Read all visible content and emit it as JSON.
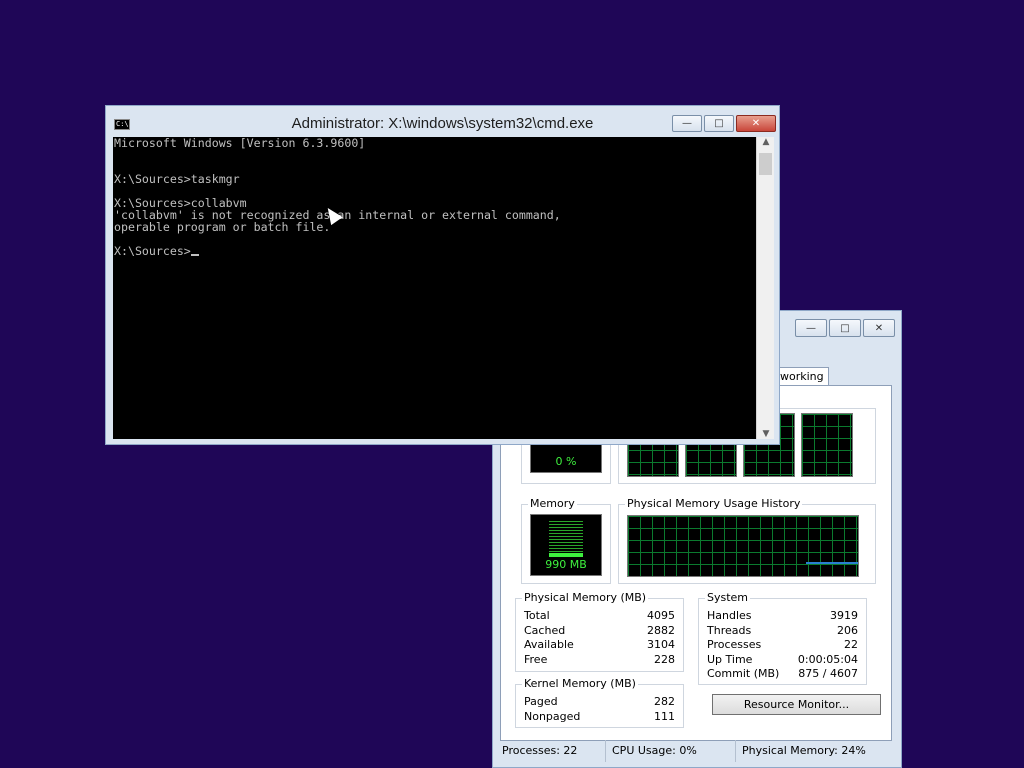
{
  "task_manager": {
    "tab_networking": "working",
    "cpu": {
      "meter_value": "0 %"
    },
    "memory": {
      "label": "Memory",
      "meter_value": "990 MB",
      "history_label": "Physical Memory Usage History"
    },
    "physical_memory": {
      "label": "Physical Memory (MB)",
      "rows": [
        {
          "name": "Total",
          "value": "4095"
        },
        {
          "name": "Cached",
          "value": "2882"
        },
        {
          "name": "Available",
          "value": "3104"
        },
        {
          "name": "Free",
          "value": "228"
        }
      ]
    },
    "kernel_memory": {
      "label": "Kernel Memory (MB)",
      "rows": [
        {
          "name": "Paged",
          "value": "282"
        },
        {
          "name": "Nonpaged",
          "value": "111"
        }
      ]
    },
    "system": {
      "label": "System",
      "rows": [
        {
          "name": "Handles",
          "value": "3919"
        },
        {
          "name": "Threads",
          "value": "206"
        },
        {
          "name": "Processes",
          "value": "22"
        },
        {
          "name": "Up Time",
          "value": "0:00:05:04"
        },
        {
          "name": "Commit (MB)",
          "value": "875 / 4607"
        }
      ]
    },
    "resource_monitor_button": "Resource Monitor...",
    "status": {
      "processes": "Processes: 22",
      "cpu_usage": "CPU Usage: 0%",
      "physical_memory": "Physical Memory: 24%"
    }
  },
  "cmd": {
    "title": "Administrator: X:\\windows\\system32\\cmd.exe",
    "icon_text": "C:\\",
    "lines": [
      "Microsoft Windows [Version 6.3.9600]",
      "",
      "",
      "X:\\Sources>taskmgr",
      "",
      "X:\\Sources>collabvm",
      "'collabvm' is not recognized as an internal or external command,",
      "operable program or batch file.",
      "",
      "X:\\Sources>"
    ]
  },
  "colors": {
    "desktop": "#1f0657",
    "console_bg": "#000000",
    "console_text": "#c0c0c0",
    "meter_green": "#3ef03e"
  }
}
